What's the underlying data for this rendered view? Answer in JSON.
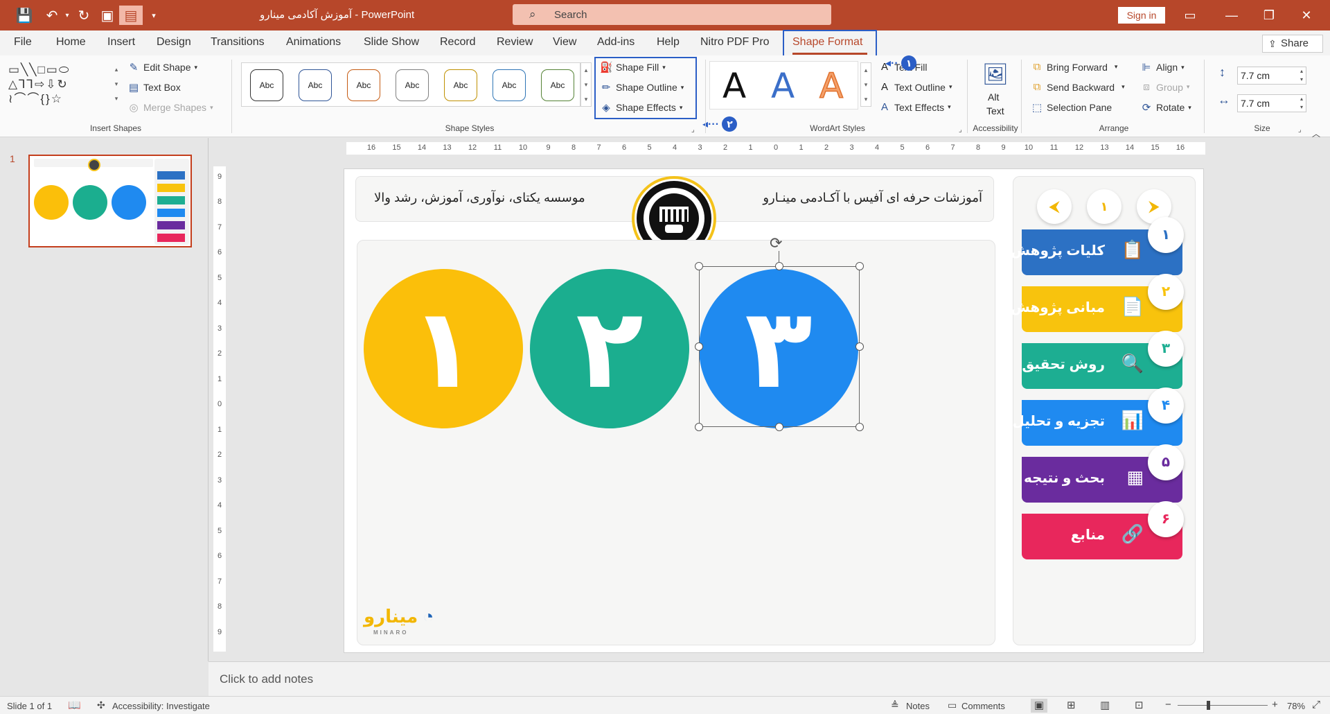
{
  "titlebar": {
    "doc_title": "آموزش آکادمی مینارو",
    "separator": " - ",
    "app_name": "PowerPoint",
    "search_placeholder": "Search",
    "signin": "Sign in"
  },
  "tabs": [
    "File",
    "Home",
    "Insert",
    "Design",
    "Transitions",
    "Animations",
    "Slide Show",
    "Record",
    "Review",
    "View",
    "Add-ins",
    "Help",
    "Nitro PDF Pro",
    "Shape Format"
  ],
  "active_tab": "Shape Format",
  "share": "Share",
  "ribbon": {
    "insert_shapes": {
      "edit_shape": "Edit Shape",
      "text_box": "Text Box",
      "merge_shapes": "Merge Shapes",
      "name": "Insert Shapes"
    },
    "shape_styles": {
      "swatch_label": "Abc",
      "swatch_colors": [
        "#333333",
        "#2f5597",
        "#c55a11",
        "#7f7f7f",
        "#bf9000",
        "#2e75b6",
        "#548235"
      ],
      "shape_fill": "Shape Fill",
      "shape_outline": "Shape Outline",
      "shape_effects": "Shape Effects",
      "name": "Shape Styles"
    },
    "wordart": {
      "glyph": "A",
      "text_fill": "Text Fill",
      "text_outline": "Text Outline",
      "text_effects": "Text Effects",
      "name": "WordArt Styles"
    },
    "accessibility": {
      "alt_text_1": "Alt",
      "alt_text_2": "Text",
      "name": "Accessibility"
    },
    "arrange": {
      "bring_forward": "Bring Forward",
      "send_backward": "Send Backward",
      "selection_pane": "Selection Pane",
      "align": "Align",
      "group": "Group",
      "rotate": "Rotate",
      "name": "Arrange"
    },
    "size": {
      "height": "7.7 cm",
      "width": "7.7 cm",
      "name": "Size"
    }
  },
  "annotations": {
    "first": "۱",
    "second": "۲"
  },
  "slides_pane": {
    "number": "1"
  },
  "slide": {
    "header_right": "آموزشات حرفه ای آفیس با آکـادمی مینـارو",
    "header_left": "موسسه یکتای، نوآوری، آموزش، رشد والا",
    "circles": [
      {
        "digit": "۱",
        "color": "#fbbf0a"
      },
      {
        "digit": "۲",
        "color": "#1bae8f"
      },
      {
        "digit": "۳",
        "color": "#1f8af0"
      }
    ],
    "nav": {
      "prev": "⮜",
      "page": "۱",
      "next": "⮞"
    },
    "menu": [
      {
        "num": "۱",
        "label": "کلیات پژوهش",
        "color": "#2c71c4",
        "icon": "📋"
      },
      {
        "num": "۲",
        "label": "مبانی پژوهش",
        "color": "#f8c30d",
        "icon": "📄"
      },
      {
        "num": "۳",
        "label": "روش تحقیق",
        "color": "#1dae92",
        "icon": "🔍"
      },
      {
        "num": "۴",
        "label": "تجزیه و تحلیل",
        "color": "#1f8af0",
        "icon": "📊"
      },
      {
        "num": "۵",
        "label": "بحث و نتیجه",
        "color": "#6a2c9e",
        "icon": "▦"
      },
      {
        "num": "۶",
        "label": "منابع",
        "color": "#e8275c",
        "icon": "🔗"
      }
    ],
    "logo_text": "مینارو",
    "logo_sub": "MINARO"
  },
  "notes_placeholder": "Click to add notes",
  "status": {
    "slide_of": "Slide 1 of 1",
    "accessibility": "Accessibility: Investigate",
    "notes": "Notes",
    "comments": "Comments",
    "zoom": "78%"
  }
}
